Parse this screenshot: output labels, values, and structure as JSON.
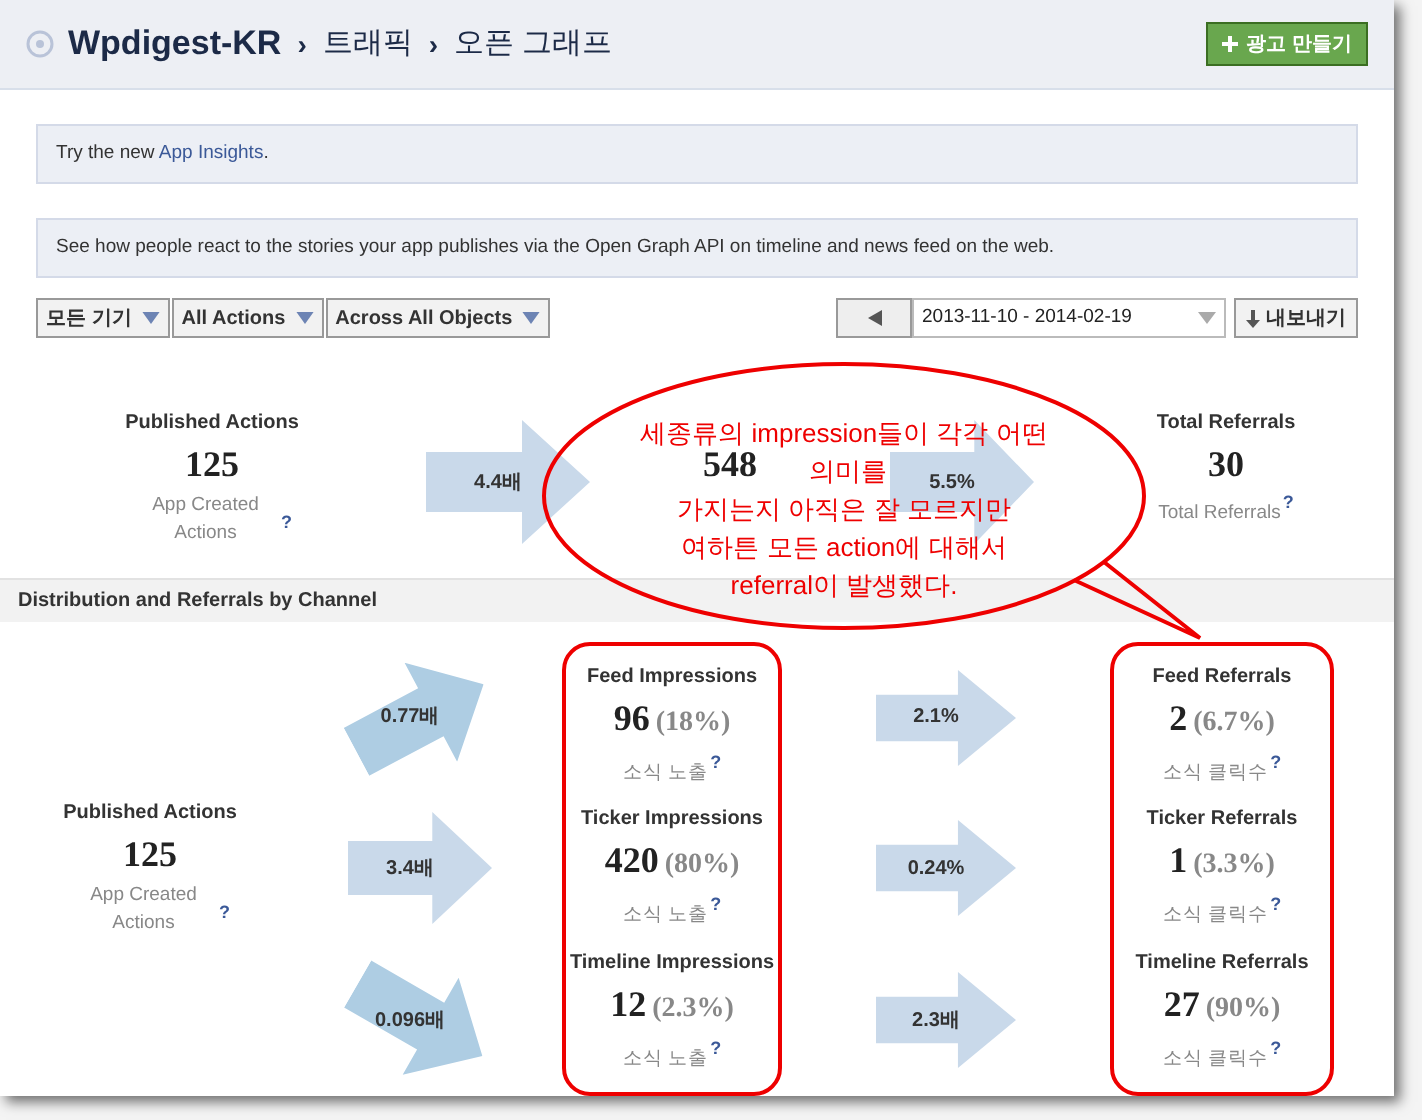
{
  "header": {
    "app_name": "Wpdigest-KR",
    "separator": "›",
    "breadcrumbs": [
      "트래픽",
      "오픈 그래프"
    ],
    "create_ad_button": "광고 만들기"
  },
  "banners": [
    {
      "text_before": "Try the new ",
      "link": "App Insights",
      "text_after": "."
    },
    {
      "text_before": "See how people react to the stories your app publishes via the Open Graph API on timeline and news feed on the web."
    }
  ],
  "filters": [
    "모든 기기",
    "All Actions",
    "Across All Objects"
  ],
  "date_range": "2013-11-10 - 2014-02-19",
  "export_button": "내보내기",
  "summary": [
    {
      "kind": "stat",
      "title": "Published Actions",
      "value": "125",
      "sub": "App Created Actions",
      "help": "?"
    },
    {
      "kind": "arrow",
      "label": "4.4배"
    },
    {
      "kind": "stat",
      "value": "548"
    },
    {
      "kind": "arrow",
      "label": "5.5%"
    },
    {
      "kind": "stat",
      "title": "Total Referrals",
      "value": "30",
      "sub": "Total Referrals",
      "help": "?"
    }
  ],
  "section_title": "Distribution and Referrals by Channel",
  "source": {
    "title": "Published Actions",
    "value": "125",
    "sub": "App Created Actions",
    "help": "?"
  },
  "fan_arrows": [
    {
      "label": "0.77배",
      "kind": "up"
    },
    {
      "label": "3.4배",
      "kind": "straight"
    },
    {
      "label": "0.096배",
      "kind": "down"
    }
  ],
  "impressions": [
    {
      "title": "Feed Impressions",
      "value": "96",
      "share": "(18%)",
      "sub": "소식 노출",
      "help": "?"
    },
    {
      "title": "Ticker Impressions",
      "value": "420",
      "share": "(80%)",
      "sub": "소식 노출",
      "help": "?"
    },
    {
      "title": "Timeline Impressions",
      "value": "12",
      "share": "(2.3%)",
      "sub": "소식 노출",
      "help": "?"
    }
  ],
  "conversion_arrows": [
    "2.1%",
    "0.24%",
    "2.3배"
  ],
  "referrals": [
    {
      "title": "Feed Referrals",
      "value": "2",
      "share": "(6.7%)",
      "sub": "소식 클릭수",
      "help": "?"
    },
    {
      "title": "Ticker Referrals",
      "value": "1",
      "share": "(3.3%)",
      "sub": "소식 클릭수",
      "help": "?"
    },
    {
      "title": "Timeline Referrals",
      "value": "27",
      "share": "(90%)",
      "sub": "소식 클릭수",
      "help": "?"
    }
  ],
  "annotation": {
    "lines": [
      "세종류의 impression들이 각각 어떤",
      "의미를",
      "가지는지 아직은 잘 모르지만",
      "여하튼 모든 action에 대해서",
      "referral이 발생했다."
    ]
  }
}
